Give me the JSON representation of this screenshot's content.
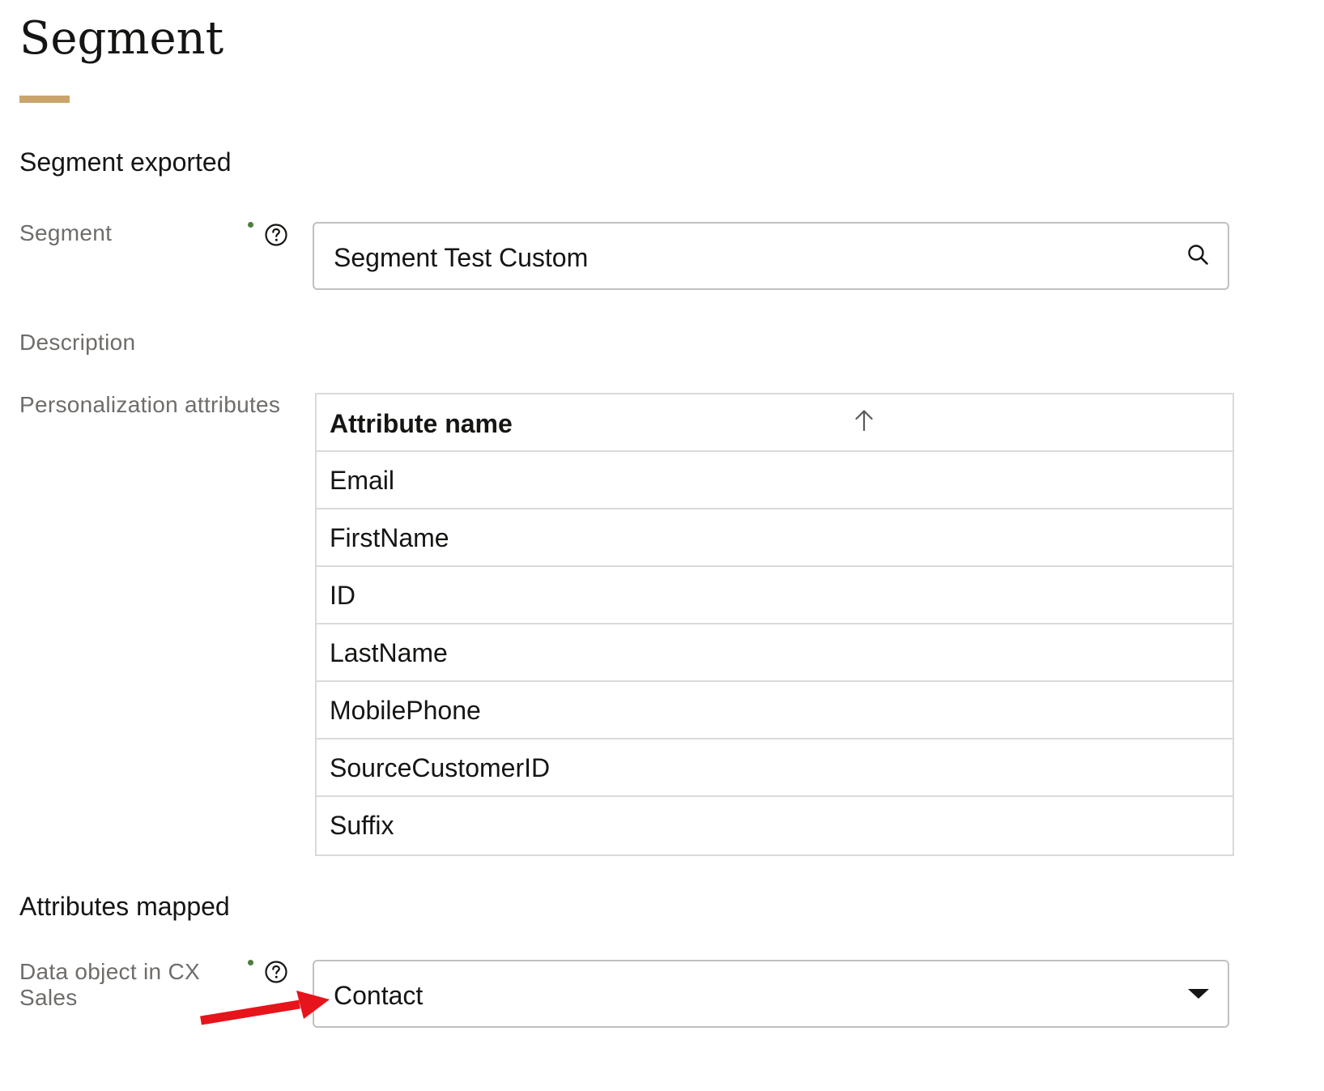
{
  "page": {
    "title": "Segment"
  },
  "segment_exported": {
    "heading": "Segment exported",
    "segment_label": "Segment",
    "segment_value": "Segment Test Custom",
    "description_label": "Description",
    "personalization_label": "Personalization attributes",
    "attributes_table": {
      "header": "Attribute name",
      "sort": "ascending",
      "rows": [
        "Email",
        "FirstName",
        "ID",
        "LastName",
        "MobilePhone",
        "SourceCustomerID",
        "Suffix"
      ]
    }
  },
  "attributes_mapped": {
    "heading": "Attributes mapped",
    "data_object_label": "Data object in CX Sales",
    "data_object_value": "Contact"
  },
  "icons": {
    "help": "question-circle-icon",
    "search": "search-icon",
    "sort": "arrow-up-icon",
    "dropdown": "caret-down-icon",
    "annotation": "red-arrow-annotation"
  },
  "colors": {
    "accent_underline": "#c9a46b",
    "required_dot": "#4f7d3d",
    "label_gray": "#6f6c69",
    "annotation_red": "#e8141b"
  }
}
